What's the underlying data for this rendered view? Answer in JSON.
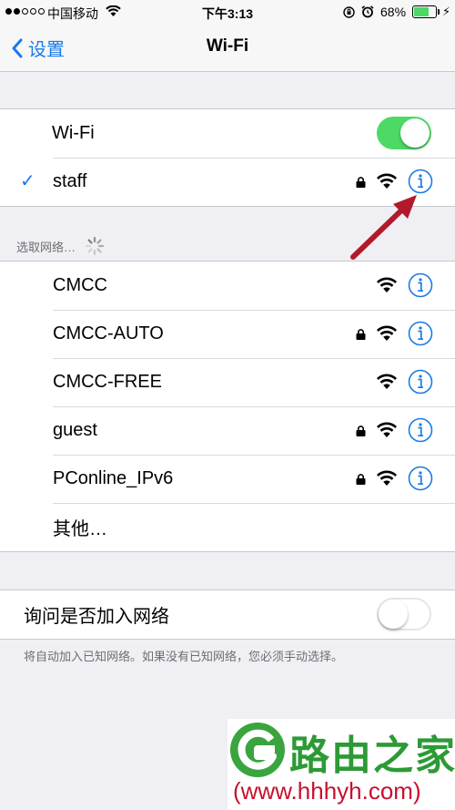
{
  "status_bar": {
    "carrier": "中国移动",
    "time": "下午3:13",
    "battery": "68%",
    "battery_level": 0.68
  },
  "nav": {
    "back_label": "设置",
    "title": "Wi-Fi"
  },
  "wifi_toggle": {
    "label": "Wi-Fi",
    "on": true
  },
  "connected": {
    "name": "staff",
    "locked": true
  },
  "choose_network_header": "选取网络…",
  "networks": [
    {
      "name": "CMCC",
      "locked": false
    },
    {
      "name": "CMCC-AUTO",
      "locked": true
    },
    {
      "name": "CMCC-FREE",
      "locked": false
    },
    {
      "name": "guest",
      "locked": true
    },
    {
      "name": "PConline_IPv6",
      "locked": true
    }
  ],
  "other_label": "其他…",
  "ask_join": {
    "label": "询问是否加入网络",
    "on": false
  },
  "footer_note": "将自动加入已知网络。如果没有已知网络，您必须手动选择。",
  "watermark": {
    "title": "路由之家",
    "url": "(www.hhhyh.com)"
  },
  "colors": {
    "accent": "#1a7ae8",
    "switch_on": "#4cd964",
    "arrow": "#b11a2a",
    "watermark_green": "#2d9a35"
  }
}
